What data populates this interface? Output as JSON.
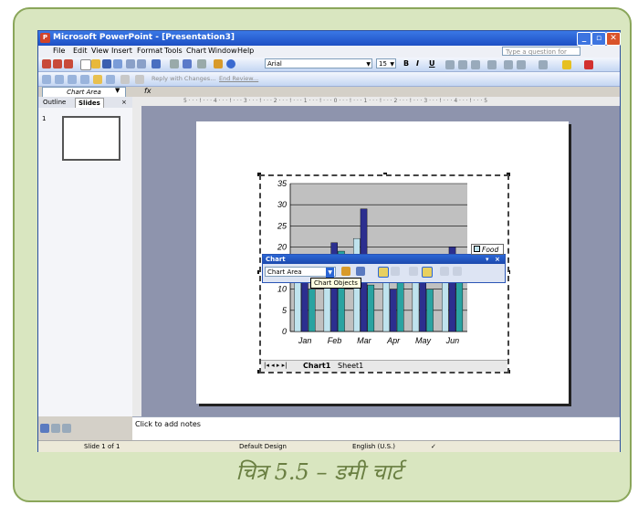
{
  "window": {
    "title": "Microsoft PowerPoint - [Presentation3]"
  },
  "menu": {
    "items": [
      "File",
      "Edit",
      "View",
      "Insert",
      "Format",
      "Tools",
      "Chart",
      "Window",
      "Help"
    ],
    "help_placeholder": "Type a question for help"
  },
  "toolbar": {
    "font_name": "Arial",
    "font_size": "15",
    "bold": "B",
    "italic": "I",
    "underline": "U",
    "reply_text": "Reply with Changes...",
    "end_review": "End Review..."
  },
  "formula_bar": {
    "name_box": "Chart Area",
    "fx": "fx"
  },
  "panel": {
    "tabs": [
      "Outline",
      "Slides"
    ],
    "close": "×",
    "slide_number": "1"
  },
  "ruler": {
    "horizontal": "5 · · · ! · · · 4 · · · ! · · · 3 · · · ! · · · 2 · · · ! · · · 1 · · · ! · · · 0 · · · ! · · · 1 · · · ! · · · 2 · · · ! · · · 3 · · · ! · · · 4 · · · ! · · · 5"
  },
  "chart_toolbar": {
    "title": "Chart",
    "dropdown_value": "Chart Area",
    "tooltip": "Chart Objects"
  },
  "sheet_tabs": [
    "Chart1",
    "Sheet1"
  ],
  "notes": {
    "placeholder": "Click to add notes"
  },
  "status": {
    "slide": "Slide 1 of 1",
    "design": "Default Design",
    "language": "English (U.S.)"
  },
  "caption": "चित्र 5.5 – डमी चार्ट",
  "chart_data": {
    "type": "bar",
    "categories": [
      "Jan",
      "Feb",
      "Mar",
      "Apr",
      "May",
      "Jun"
    ],
    "series": [
      {
        "name": "Food",
        "values": [
          12,
          15,
          22,
          15,
          12,
          16
        ],
        "color": "#bfe3ee"
      },
      {
        "values": [
          17,
          21,
          29,
          10,
          15,
          20
        ],
        "color": "#2c2f8f"
      },
      {
        "values": [
          10,
          19,
          11,
          13,
          10,
          13
        ],
        "color": "#2aa3a1"
      }
    ],
    "ylim": [
      0,
      35
    ],
    "yticks": [
      0,
      5,
      10,
      15,
      20,
      25,
      30,
      35
    ],
    "grid": true,
    "plot_background": "#c0c0c0",
    "legend_position": "right"
  }
}
